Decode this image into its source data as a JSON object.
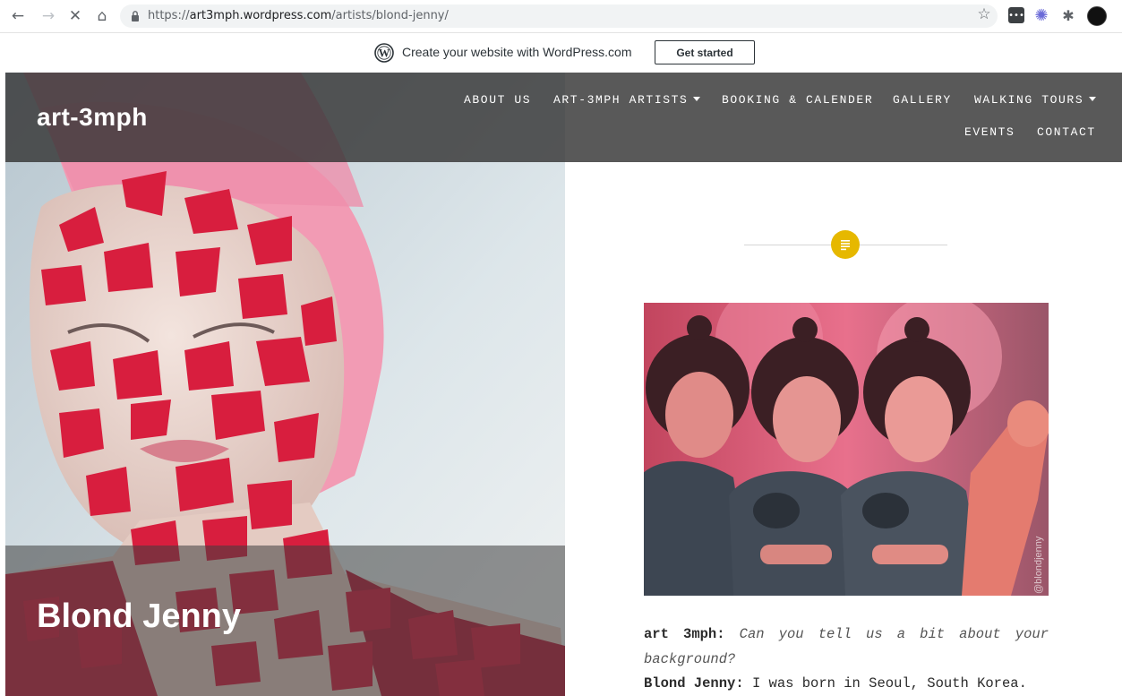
{
  "browser": {
    "url_prefix": "https://",
    "url_domain": "art3mph.wordpress.com",
    "url_path": "/artists/blond-jenny/",
    "icons": [
      "back-arrow-icon",
      "forward-arrow-icon",
      "stop-icon",
      "home-icon",
      "lock-icon",
      "star-icon",
      "extension-icon",
      "extension-icon",
      "puzzle-icon",
      "profile-icon",
      "kebab-icon"
    ]
  },
  "promo": {
    "text": "Create your website with WordPress.com",
    "button": "Get started"
  },
  "site": {
    "title": "art-3mph",
    "menu": [
      {
        "label": "ABOUT US",
        "dropdown": false
      },
      {
        "label": "ART-3MPH ARTISTS",
        "dropdown": true
      },
      {
        "label": "BOOKING & CALENDER",
        "dropdown": false
      },
      {
        "label": "GALLERY",
        "dropdown": false
      },
      {
        "label": "WALKING TOURS",
        "dropdown": true
      },
      {
        "label": "EVENTS",
        "dropdown": false
      },
      {
        "label": "CONTACT",
        "dropdown": false
      }
    ]
  },
  "page": {
    "title": "Blond Jenny",
    "image_watermark": "@blondjenny",
    "interview": {
      "q_speaker": "art 3mph:",
      "q_text": "Can you tell us a bit about your background?",
      "a_speaker": "Blond Jenny:",
      "a_text": "I was born in Seoul, South Korea."
    }
  },
  "colors": {
    "header_overlay": "#343434",
    "badge": "#e6b800",
    "petal": "#d81e3e",
    "hair": "#f29bb4"
  }
}
